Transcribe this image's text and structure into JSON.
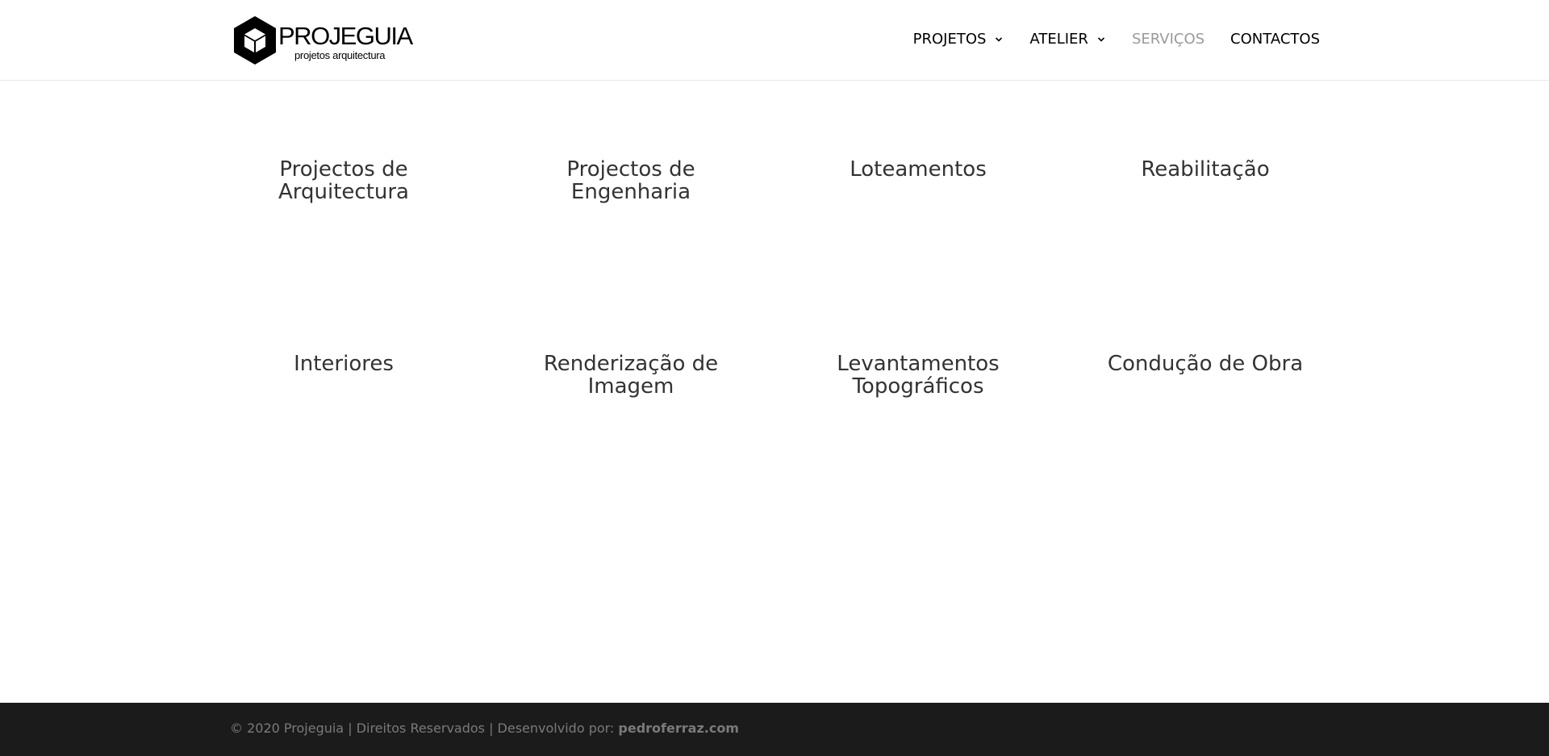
{
  "header": {
    "logo": {
      "name": "PROJEGUIA",
      "tagline": "projetos arquitectura"
    },
    "nav": [
      {
        "label": "PROJETOS",
        "has_dropdown": true
      },
      {
        "label": "ATELIER",
        "has_dropdown": true
      },
      {
        "label": "SERVIÇOS",
        "has_dropdown": false,
        "active": true
      },
      {
        "label": "CONTACTOS",
        "has_dropdown": false
      }
    ]
  },
  "services": {
    "row1": [
      {
        "line1": "Projectos de",
        "line2": "Arquitectura"
      },
      {
        "line1": "Projectos de",
        "line2": "Engenharia"
      },
      {
        "line1": "Loteamentos",
        "line2": ""
      },
      {
        "line1": "Reabilitação",
        "line2": ""
      }
    ],
    "row2": [
      {
        "line1": "Interiores",
        "line2": ""
      },
      {
        "line1": "Renderização de",
        "line2": "Imagem"
      },
      {
        "line1": "Levantamentos",
        "line2": "Topográficos"
      },
      {
        "line1": "Condução de Obra",
        "line2": ""
      }
    ]
  },
  "footer": {
    "text": "© 2020 Projeguia | Direitos Reservados | Desenvolvido por: ",
    "link": "pedroferraz.com"
  },
  "colors": {
    "nav_active": "#9a9a9a",
    "nav_default": "#000000",
    "footer_bg": "#1b1b1b",
    "footer_text": "#7a7a7a",
    "heading": "#333333"
  },
  "icons": {
    "logo_mark": "hexagon-cube-icon",
    "dropdown": "chevron-down-icon"
  }
}
